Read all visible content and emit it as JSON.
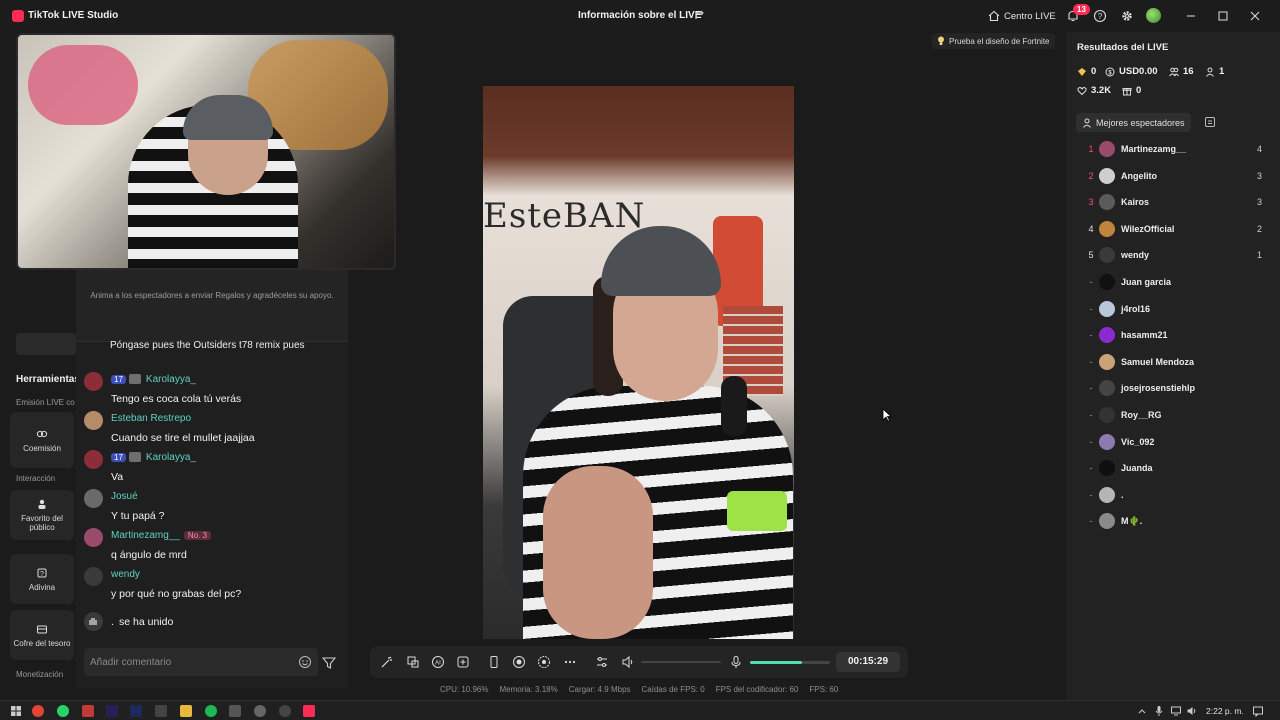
{
  "titlebar": {
    "app_title": "TikTok LIVE Studio",
    "center_title": "Información sobre el LIVE",
    "live_center": "Centro LIVE",
    "notification_count": "13"
  },
  "left": {
    "tools_title": "Herramientas",
    "emision_label": "Emisión LIVE co",
    "interaccion_label": "Interacción",
    "monetizacion_label": "Monetización",
    "tools": [
      {
        "label": "Coemisión"
      },
      {
        "label": "Favorito del público"
      },
      {
        "label": "Adivina"
      },
      {
        "label": "Cofre del tesoro"
      }
    ]
  },
  "chat": {
    "tip": "Anima a los espectadores a enviar Regalos y agradéceles su apoyo.",
    "cut_message": "Póngase pues the Outsiders t78 remix pues",
    "messages": [
      {
        "user": "Karolayya_",
        "level": "17",
        "text": "Tengo es coca cola tú verás",
        "avatar_color": "#8b2e3a"
      },
      {
        "user": "Esteban Restrepo",
        "level": "",
        "text": "Cuando se tire el mullet jaajjaa",
        "avatar_color": "#b58c6a"
      },
      {
        "user": "Karolayya_",
        "level": "17",
        "text": "Va",
        "avatar_color": "#8b2e3a"
      },
      {
        "user": "Josué",
        "level": "",
        "text": "Y tu papá ?",
        "avatar_color": "#6a6a6a"
      },
      {
        "user": "Martinezamg__",
        "level": "",
        "rank": "No. 3",
        "text": "q ángulo de mrd",
        "avatar_color": "#9a4b6a"
      },
      {
        "user": "wendy",
        "level": "",
        "text": "y por qué no grabas del pc?",
        "avatar_color": "#3a3a3a"
      }
    ],
    "join_user": ".",
    "join_text": "se ha unido",
    "comment_placeholder": "Añadir comentario"
  },
  "video": {
    "wall_text": "EsteBAN"
  },
  "controls": {
    "timer": "00:15:29",
    "mic_level": 0.65
  },
  "stats": {
    "cpu": "CPU:  10.96%",
    "memoria": "Memoria:  3.18%",
    "cargar": "Cargar:  4.9 Mbps",
    "caidas": "Caídas de FPS:  0",
    "fps_cod": "FPS del codificador:  60",
    "fps": "FPS:  60"
  },
  "fortnite_tip": "Prueba el diseño de Fortnite",
  "results": {
    "title": "Resultados del LIVE",
    "diamonds": "0",
    "usd": "USD0.00",
    "viewers": "16",
    "shares": "1",
    "likes": "3.2K",
    "gifts": "0",
    "best_viewers_label": "Mejores espectadores",
    "viewers_list": [
      {
        "rank": "1",
        "name": "Martinezamg__",
        "score": "4",
        "color": "#9a4b6a",
        "rank_color": "#ff4d6d"
      },
      {
        "rank": "2",
        "name": "Angelito",
        "score": "3",
        "color": "#cfcfcf",
        "rank_color": "#ff4d6d"
      },
      {
        "rank": "3",
        "name": "Kairos",
        "score": "3",
        "color": "#5b5b5b",
        "rank_color": "#ff4d6d"
      },
      {
        "rank": "4",
        "name": "WilezOfficial",
        "score": "2",
        "color": "#c0843e",
        "rank_color": "#e0e0e0"
      },
      {
        "rank": "5",
        "name": "wendy",
        "score": "1",
        "color": "#3a3a3a",
        "rank_color": "#e0e0e0"
      },
      {
        "rank": "-",
        "name": "Juan garcia",
        "score": "",
        "color": "#111111",
        "rank_color": "#9a9a9a"
      },
      {
        "rank": "-",
        "name": "j4rol16",
        "score": "",
        "color": "#b9c7d8",
        "rank_color": "#9a9a9a"
      },
      {
        "rank": "-",
        "name": "hasamm21",
        "score": "",
        "color": "#8a2bd2",
        "rank_color": "#9a9a9a"
      },
      {
        "rank": "-",
        "name": "Samuel Mendoza",
        "score": "",
        "color": "#c9a277",
        "rank_color": "#9a9a9a"
      },
      {
        "rank": "-",
        "name": "josejrosenstiehlp",
        "score": "",
        "color": "#444444",
        "rank_color": "#9a9a9a"
      },
      {
        "rank": "-",
        "name": "Roy__RG",
        "score": "",
        "color": "#333333",
        "rank_color": "#9a9a9a"
      },
      {
        "rank": "-",
        "name": "Vic_092",
        "score": "",
        "color": "#8c7bb0",
        "rank_color": "#9a9a9a"
      },
      {
        "rank": "-",
        "name": "Juanda",
        "score": "",
        "color": "#0f0f0f",
        "rank_color": "#9a9a9a"
      },
      {
        "rank": "-",
        "name": ".",
        "score": "",
        "color": "#b5b5b5",
        "rank_color": "#9a9a9a"
      },
      {
        "rank": "-",
        "name": "M🌵.",
        "score": "",
        "color": "#8a8a8a",
        "rank_color": "#9a9a9a"
      }
    ]
  },
  "taskbar": {
    "time": "2:22 p. m."
  }
}
